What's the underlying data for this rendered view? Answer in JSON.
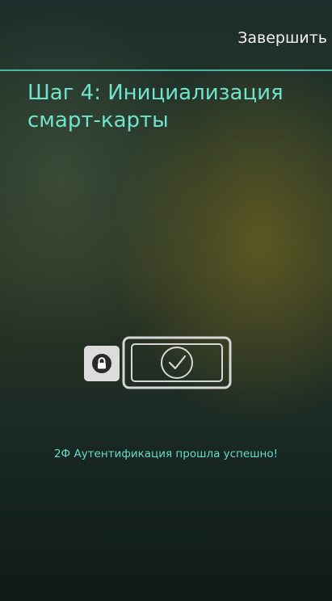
{
  "header": {
    "finish_label": "Завершить"
  },
  "page": {
    "title": "Шаг 4: Инициализация смарт-карты"
  },
  "status": {
    "message": "2Ф Аутентификация прошла успешно!"
  },
  "icons": {
    "lock": "lock-icon",
    "check": "checkmark-icon"
  },
  "colors": {
    "accent": "#6fe3cd",
    "divider": "#46b9a4",
    "success_text": "#65d9c4"
  }
}
